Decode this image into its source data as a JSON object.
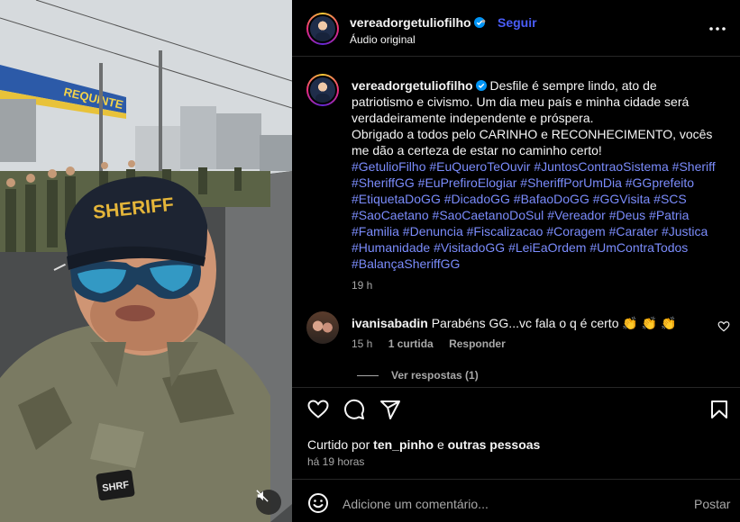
{
  "media": {
    "cap_badge_text": "SHERIFF",
    "chest_patch_text": "SHRF",
    "store_sign": "REQUINTE",
    "mute_icon": "speaker-muted-icon"
  },
  "header": {
    "username": "vereadorgetuliofilho",
    "verified_icon": "verified-badge-icon",
    "separator": "•",
    "follow_label": "Seguir",
    "audio_label": "Áudio original",
    "more_icon": "more-horizontal-icon"
  },
  "caption": {
    "username": "vereadorgetuliofilho",
    "text_1": "Desfile é sempre lindo, ato de patriotismo e civismo. Um dia meu país e minha cidade será verdadeiramente independente e próspera.",
    "text_2": "Obrigado a todos pelo CARINHO e RECONHECIMENTO, vocês me dão a certeza de estar no caminho certo!",
    "hashtags": [
      "#GetulioFilho",
      "#EuQueroTeOuvir",
      "#JuntosContraoSistema",
      "#Sheriff",
      "#SheriffGG",
      "#EuPrefiroElogiar",
      "#SheriffPorUmDia",
      "#GGprefeito",
      "#EtiquetaDoGG",
      "#DicadoGG",
      "#BafaoDoGG",
      "#GGVisita",
      "#SCS",
      "#SaoCaetano",
      "#SaoCaetanoDoSul",
      "#Vereador",
      "#Deus",
      "#Patria",
      "#Familia",
      "#Denuncia",
      "#Fiscalizacao",
      "#Coragem",
      "#Carater",
      "#Justica",
      "#Humanidade",
      "#VisitadoGG",
      "#LeiEaOrdem",
      "#UmContraTodos",
      "#BalançaSheriffGG"
    ],
    "time": "19 h"
  },
  "comment": {
    "username": "ivanisabadin",
    "text": "Parabéns GG...vc fala o q é certo 👏 👏 👏",
    "time": "15 h",
    "likes": "1 curtida",
    "reply_label": "Responder",
    "view_replies": "Ver respostas (1)",
    "heart_icon": "heart-outline-icon"
  },
  "actions": {
    "like_icon": "heart-icon",
    "comment_icon": "comment-bubble-icon",
    "share_icon": "send-icon",
    "save_icon": "bookmark-icon"
  },
  "likes": {
    "prefix": "Curtido por",
    "user": "ten_pinho",
    "joiner": "e",
    "others": "outras pessoas",
    "ago": "há 19 horas"
  },
  "add_comment": {
    "placeholder": "Adicione um comentário...",
    "post_label": "Postar",
    "emoji_icon": "smiley-icon"
  }
}
